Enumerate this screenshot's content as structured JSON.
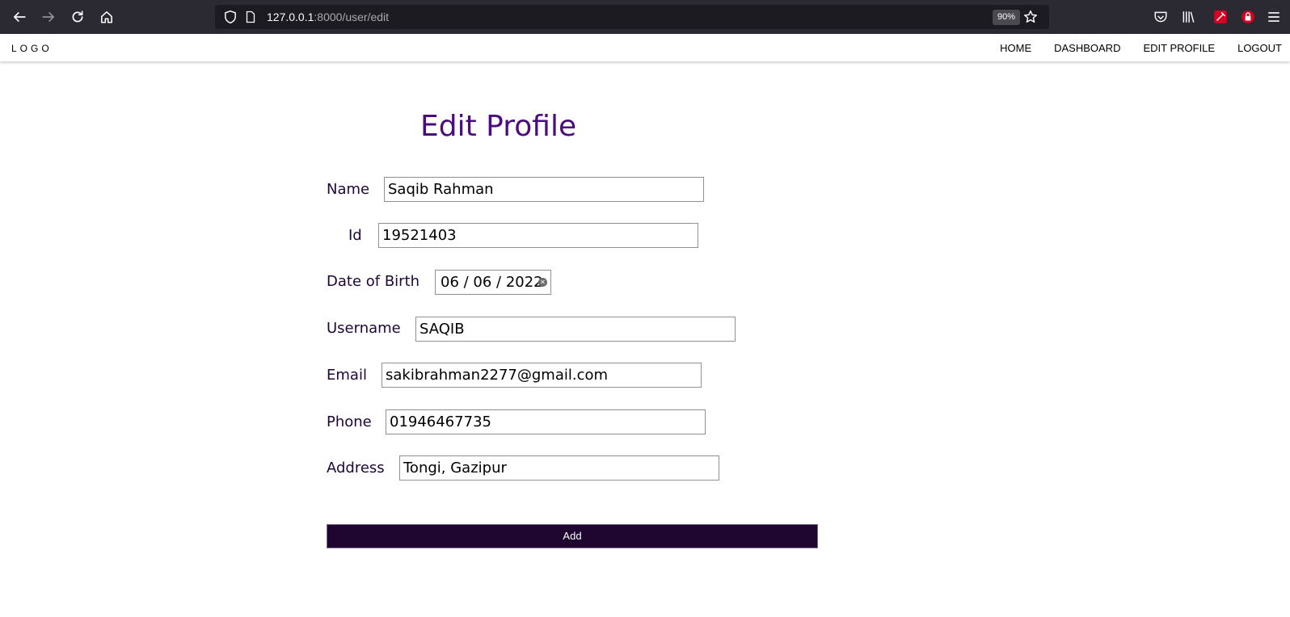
{
  "browser": {
    "url_host": "127.0.0.1",
    "url_rest": ":8000/user/edit",
    "zoom": "90%"
  },
  "navbar": {
    "logo": "LOGO",
    "links": [
      "HOME",
      "DASHBOARD",
      "EDIT PROFILE",
      "LOGOUT"
    ]
  },
  "form": {
    "title": "Edit Profile",
    "fields": {
      "name": {
        "label": "Name",
        "value": "Saqib Rahman"
      },
      "id": {
        "label": "Id",
        "value": "19521403"
      },
      "dob": {
        "label": "Date of Birth",
        "value": "06 / 06 / 2022"
      },
      "username": {
        "label": "Username",
        "value": "SAQIB"
      },
      "email": {
        "label": "Email",
        "value": "sakibrahman2277@gmail.com"
      },
      "phone": {
        "label": "Phone",
        "value": "01946467735"
      },
      "address": {
        "label": "Address",
        "value": "Tongi, Gazipur"
      }
    },
    "submit_label": "Add"
  },
  "colors": {
    "title": "#4b0c7e",
    "label": "#1e0638",
    "button_bg": "#1e0630",
    "chrome_bg": "#2b2a33"
  }
}
